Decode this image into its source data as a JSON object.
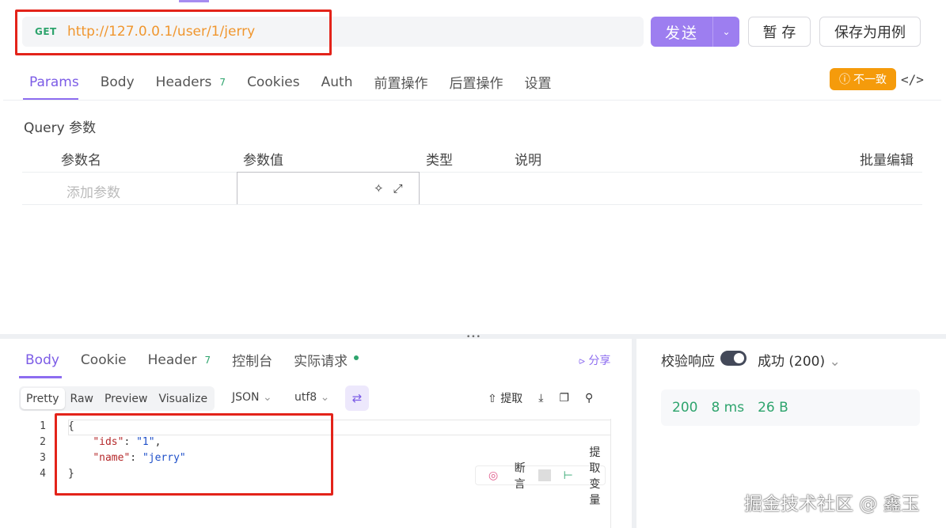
{
  "request": {
    "method": "GET",
    "url": "http://127.0.0.1/user/1/jerry",
    "send_label": "发送",
    "save_label": "暂 存",
    "save_case_label": "保存为用例"
  },
  "req_tabs": [
    {
      "label": "Params"
    },
    {
      "label": "Body"
    },
    {
      "label": "Headers",
      "badge": "7"
    },
    {
      "label": "Cookies"
    },
    {
      "label": "Auth"
    },
    {
      "label": "前置操作"
    },
    {
      "label": "后置操作"
    },
    {
      "label": "设置"
    }
  ],
  "warning_label": "不一致",
  "query": {
    "title": "Query 参数",
    "headers": {
      "name": "参数名",
      "value": "参数值",
      "type": "类型",
      "desc": "说明",
      "bulk": "批量编辑"
    },
    "add_placeholder": "添加参数"
  },
  "res_tabs": [
    {
      "label": "Body"
    },
    {
      "label": "Cookie"
    },
    {
      "label": "Header",
      "badge": "7"
    },
    {
      "label": "控制台"
    },
    {
      "label": "实际请求"
    }
  ],
  "share_label": "分享",
  "format_tabs": [
    "Pretty",
    "Raw",
    "Preview",
    "Visualize"
  ],
  "format_select": "JSON",
  "encoding_select": "utf8",
  "extract_label": "提取",
  "code": {
    "line_numbers": [
      "1",
      "2",
      "3",
      "4"
    ],
    "open": "{",
    "key1": "\"ids\"",
    "val1": "\"1\"",
    "key2": "\"name\"",
    "val2": "\"jerry\"",
    "close": "}"
  },
  "assert_label": "断言",
  "extract_var_label": "提取变量",
  "validate_label": "校验响应",
  "validate_on": true,
  "status_label": "成功 (200)",
  "stats": {
    "code": "200",
    "time": "8 ms",
    "size": "26 B"
  },
  "watermark": "掘金技术社区 @ 鑫玉",
  "colors": {
    "accent": "#8d6df0",
    "success": "#2ea46d",
    "warning": "#f59b0b",
    "annotation": "#e3231a"
  }
}
